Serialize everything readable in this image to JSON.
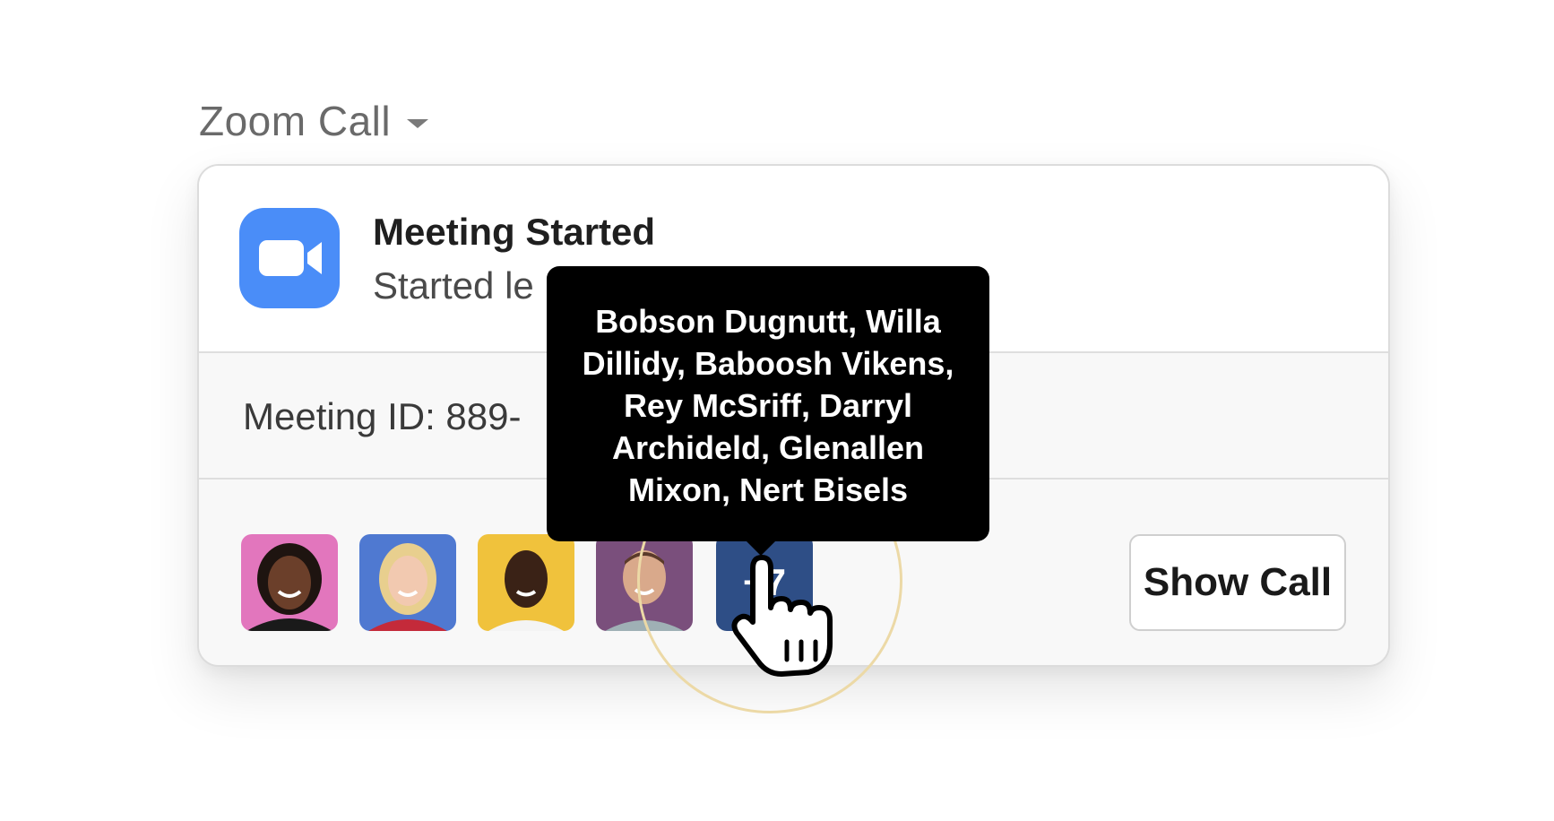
{
  "header": {
    "title": "Zoom Call"
  },
  "card": {
    "meeting_title": "Meeting Started",
    "meeting_subtitle": "Started le",
    "meeting_id_text": "Meeting ID: 889-",
    "more_count": "+7",
    "show_call_label": "Show Call",
    "avatars": [
      {
        "name": "participant-1",
        "bg": "#e276bd"
      },
      {
        "name": "participant-2",
        "bg": "#4f79d1"
      },
      {
        "name": "participant-3",
        "bg": "#f0c23c"
      },
      {
        "name": "participant-4",
        "bg": "#7a4f7c"
      }
    ]
  },
  "tooltip": {
    "text": "Bobson Dugnutt, Willa Dillidy, Baboosh Vikens, Rey McSriff, Darryl Archideld, Glenallen Mixon, Nert Bisels"
  },
  "icons": {
    "app_logo": "video-camera-icon",
    "dropdown": "chevron-down-icon",
    "cursor": "hand-pointer-icon"
  },
  "colors": {
    "zoom_blue": "#4a8df8",
    "tooltip_bg": "#000000",
    "more_tile": "#2e4e86"
  }
}
